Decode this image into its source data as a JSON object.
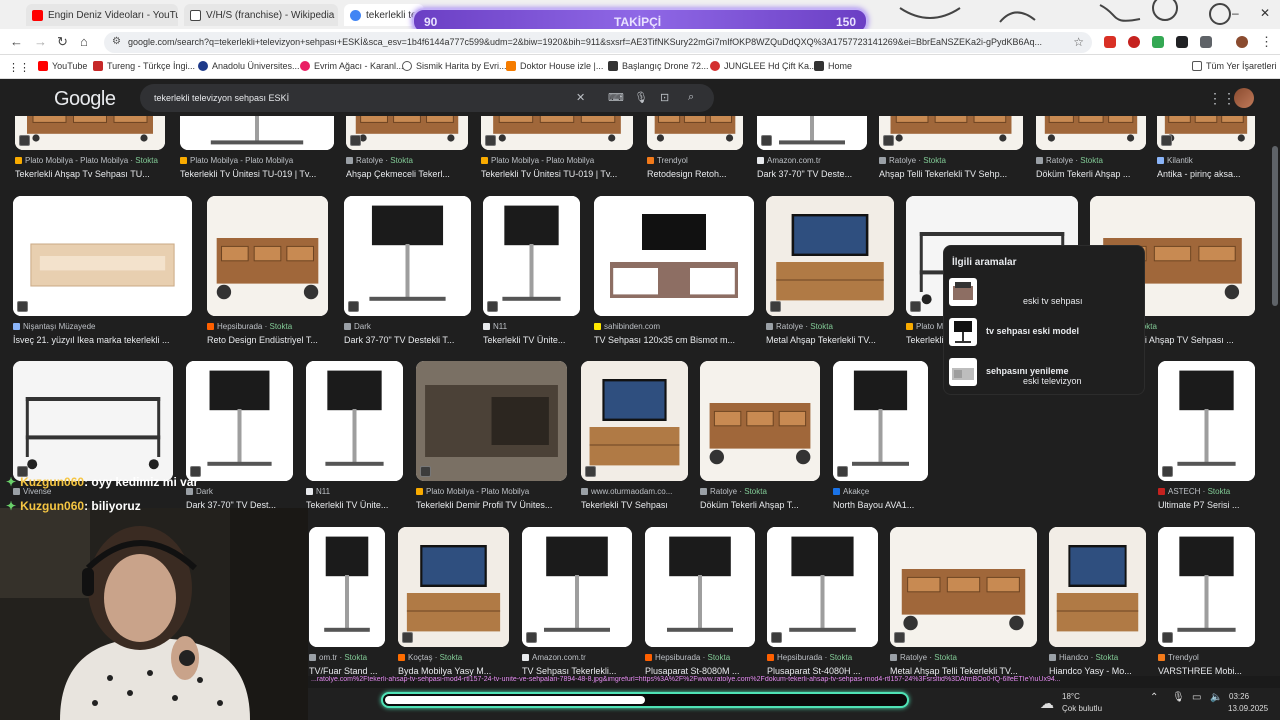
{
  "browser": {
    "tabs": [
      {
        "title": "Engin Deniz Videoları - YouTube",
        "icon": "youtube-icon",
        "color": "#ff0000"
      },
      {
        "title": "V/H/S (franchise) - Wikipedia",
        "icon": "wikipedia-icon",
        "color": "#000000"
      },
      {
        "title": "tekerlekli tele",
        "icon": "google-icon",
        "color": "#4285f4"
      }
    ],
    "url": "google.com/search?q=tekerlekli+televizyon+sehpası+ESKİ&sca_esv=1b4f6144a777c599&udm=2&biw=1920&bih=911&sxsrf=AE3TifNKSury22mGi7mIfOKP8WZQuDdQXQ%3A1757723141269&ei=BbrEaNSZEKa2i-gPydKB6Aq...",
    "bookmarks": [
      {
        "label": "YouTube",
        "icon": "youtube-icon",
        "color": "#ff0000"
      },
      {
        "label": "Tureng - Türkçe İngi...",
        "icon": "tureng-icon",
        "color": "#c62828"
      },
      {
        "label": "Anadolu Üniversites...",
        "icon": "anadolu-icon",
        "color": "#1e3a8a"
      },
      {
        "label": "Evrim Ağacı - Karanl...",
        "icon": "evrim-icon",
        "color": "#e91e63"
      },
      {
        "label": "Sismik Harita by Evri...",
        "icon": "sismik-icon",
        "color": "#555555"
      },
      {
        "label": "Doktor House izle |...",
        "icon": "doktor-icon",
        "color": "#f57c00"
      },
      {
        "label": "Başlangıç Drone 72...",
        "icon": "drone-icon",
        "color": "#333333"
      },
      {
        "label": "JUNGLEE Hd Çift Ka...",
        "icon": "junglee-icon",
        "color": "#d32f2f"
      },
      {
        "label": "Home",
        "icon": "home-icon",
        "color": "#333333"
      }
    ],
    "all_bookmarks": "Tüm Yer İşaretleri"
  },
  "overlay": {
    "left_count": "90",
    "label": "TAKİPÇİ",
    "right_count": "150",
    "progress_fraction": 0.5
  },
  "google": {
    "logo": "Google",
    "query": "tekerlekli televizyon sehpası ESKİ",
    "related": {
      "heading": "İlgili aramalar",
      "items": [
        {
          "prefix": "eski tv sehpası",
          "bold": ""
        },
        {
          "prefix": "",
          "bold": "tv sehpası eski model"
        },
        {
          "prefix": "eski televizyon ",
          "bold": "sehpasını yenileme"
        }
      ]
    },
    "stock_label": "Stokta",
    "results": [
      {
        "source": "Plato Mobilya - Plato Mobilya",
        "stock": true,
        "title": "Tekerlekli Ahşap Tv Sehpası TU...",
        "srccolor": "#f9ab00"
      },
      {
        "source": "Plato Mobilya - Plato Mobilya",
        "stock": false,
        "title": "Tekerlekli Tv Ünitesi TU-019 | Tv...",
        "srccolor": "#f9ab00"
      },
      {
        "source": "Ratolye",
        "stock": true,
        "title": "Ahşap Çekmeceli Tekerl...",
        "srccolor": "#9aa0a6"
      },
      {
        "source": "Plato Mobilya - Plato Mobilya",
        "stock": false,
        "title": "Tekerlekli Tv Ünitesi TU-019 | Tv...",
        "srccolor": "#f9ab00"
      },
      {
        "source": "Trendyol",
        "stock": false,
        "title": "Retodesign Retoh...",
        "srccolor": "#f27a1a"
      },
      {
        "source": "Amazon.com.tr",
        "stock": false,
        "title": "Dark 37-70\" TV Deste...",
        "srccolor": "#e8eaed"
      },
      {
        "source": "Ratolye",
        "stock": true,
        "title": "Ahşap Telli Tekerlekli TV Sehp...",
        "srccolor": "#9aa0a6"
      },
      {
        "source": "Ratolye",
        "stock": true,
        "title": "Döküm Tekerli Ahşap ...",
        "srccolor": "#9aa0a6"
      },
      {
        "source": "Kilantik",
        "stock": false,
        "title": "Antika - pirinç aksa...",
        "srccolor": "#8ab4f8"
      },
      {
        "source": "Nişantaşı Müzayede",
        "stock": false,
        "title": "İsveç 21. yüzyıl Ikea marka tekerlekli ...",
        "srccolor": "#8ab4f8"
      },
      {
        "source": "Hepsiburada",
        "stock": true,
        "title": "Reto Design Endüstriyel T...",
        "srccolor": "#ff6000"
      },
      {
        "source": "Dark",
        "stock": false,
        "title": "Dark 37-70\" TV Destekli T...",
        "srccolor": "#9aa0a6"
      },
      {
        "source": "N11",
        "stock": false,
        "title": "Tekerlekli TV Ünite...",
        "srccolor": "#e8eaed"
      },
      {
        "source": "sahibinden.com",
        "stock": false,
        "title": "TV Sehpası 120x35 cm Bismot m...",
        "srccolor": "#ffe800"
      },
      {
        "source": "Ratolye",
        "stock": true,
        "title": "Metal Ahşap Tekerlekli TV...",
        "srccolor": "#9aa0a6"
      },
      {
        "source": "Plato Mobilya - Plato Mobilya",
        "stock": false,
        "title": "Tekerlekli Tv Ünitesi TU-019 | Tv Se...",
        "srccolor": "#f9ab00"
      },
      {
        "source": "Ratolye",
        "stock": true,
        "title": "Döküm Tekerli Ahşap TV Sehpası ...",
        "srccolor": "#9aa0a6"
      },
      {
        "source": "Vivense",
        "stock": false,
        "title": "",
        "srccolor": "#9aa0a6"
      },
      {
        "source": "Dark",
        "stock": false,
        "title": "Dark 37-70\" TV Dest...",
        "srccolor": "#9aa0a6"
      },
      {
        "source": "N11",
        "stock": false,
        "title": "Tekerlekli TV Ünite...",
        "srccolor": "#e8eaed"
      },
      {
        "source": "Plato Mobilya - Plato Mobilya",
        "stock": false,
        "title": "Tekerlekli Demir Profil TV Ünites...",
        "srccolor": "#f9ab00"
      },
      {
        "source": "www.oturmaodam.co...",
        "stock": false,
        "title": "Tekerlekli TV Sehpası",
        "srccolor": "#9aa0a6"
      },
      {
        "source": "Ratolye",
        "stock": true,
        "title": "Döküm Tekerli Ahşap T...",
        "srccolor": "#9aa0a6"
      },
      {
        "source": "Akakçe",
        "stock": false,
        "title": "North Bayou AVA1...",
        "srccolor": "#1a73e8"
      },
      {
        "source": "ASTECH",
        "stock": true,
        "title": "Ultimate P7 Serisi ...",
        "srccolor": "#c5221f"
      },
      {
        "source": "om.tr",
        "stock": true,
        "title": "TV/Fuar Stand ...",
        "srccolor": "#9aa0a6"
      },
      {
        "source": "Koçtaş",
        "stock": true,
        "title": "Byda Mobilya Yasy M...",
        "srccolor": "#ff6d00"
      },
      {
        "source": "Amazon.com.tr",
        "stock": false,
        "title": "TV Sehpası Tekerlekli...",
        "srccolor": "#e8eaed"
      },
      {
        "source": "Hepsiburada",
        "stock": true,
        "title": "Plusaparat St-8080M ...",
        "srccolor": "#ff6000"
      },
      {
        "source": "Hepsiburada",
        "stock": true,
        "title": "Plusaparat St-4080H ...",
        "srccolor": "#ff6000"
      },
      {
        "source": "Ratolye",
        "stock": true,
        "title": "Metal Ahşap Telli Tekerlekli TV...",
        "srccolor": "#9aa0a6"
      },
      {
        "source": "Hiandco",
        "stock": true,
        "title": "Hiandco Yasy - Mo...",
        "srccolor": "#9aa0a6"
      },
      {
        "source": "Trendyol",
        "stock": false,
        "title": "VARSTHREE Mobi...",
        "srccolor": "#f27a1a"
      }
    ]
  },
  "stream": {
    "chat": [
      {
        "user": "Kuzgun060",
        "msg": ": oyy kedimiz mi var"
      },
      {
        "user": "Kuzgun060",
        "msg": ": biliyoruz"
      }
    ]
  },
  "status_url": "...ratolye.com%2Ftekerli-ahsap-tv-sehpasi-mod4-rtl157-24-tv-unite-ve-sehpalari-7894-48-8.jpg&imgrefurl=https%3A%2F%2Fwww.ratolye.com%2Fdokum-tekerli-ahsap-tv-sehpasi-mod4-rtl157-24%3Fsrsltid%3DAfmBOo0-fQ-6lfeETIeYiuUx94...",
  "taskbar": {
    "weather_temp": "18°C",
    "weather_desc": "Çok bulutlu",
    "time": "03:26",
    "date": "13.09.2025"
  },
  "colors": {
    "accent": "#8ab4f8",
    "stock": "#81c995",
    "overlay": "#7b52d8",
    "progress": "#4fe3b6"
  }
}
